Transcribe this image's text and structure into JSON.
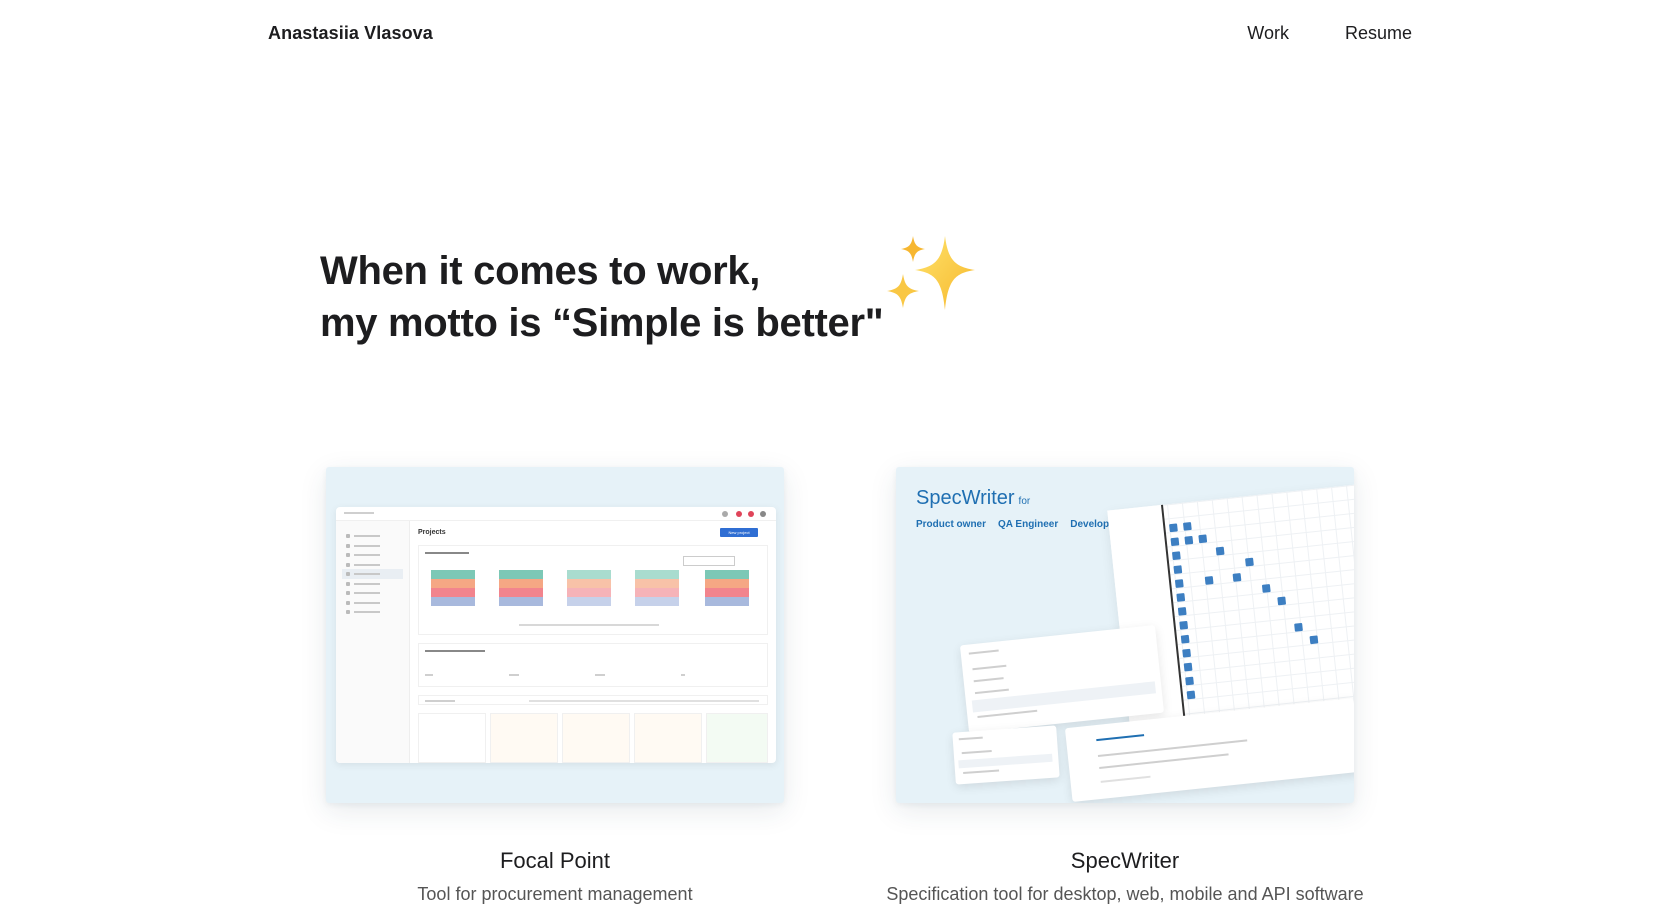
{
  "header": {
    "brand": "Anastasiia Vlasova",
    "nav": [
      {
        "label": "Work"
      },
      {
        "label": "Resume"
      }
    ]
  },
  "hero": {
    "line1": "When it comes to work,",
    "line2": "my motto is “Simple is better\"",
    "emoji_icon": "sparkles-icon"
  },
  "projects": [
    {
      "title": "Focal Point",
      "description": "Tool for procurement management",
      "preview": {
        "header": "Projects",
        "button": "New project",
        "bar_colors": [
          "#7cc8b6",
          "#f5a784",
          "#f2848d",
          "#a8b9dd"
        ]
      }
    },
    {
      "title": "SpecWriter",
      "description": "Specification tool for desktop, web, mobile and API software",
      "preview": {
        "brand": "SpecWriter",
        "for_label": "for",
        "roles": [
          "Product owner",
          "QA Engineer",
          "Developer"
        ],
        "accent": "#1f6fb2"
      }
    }
  ],
  "colors": {
    "card_bg": "#e6f2f8",
    "text": "#1d1d1f",
    "muted": "#555555"
  }
}
